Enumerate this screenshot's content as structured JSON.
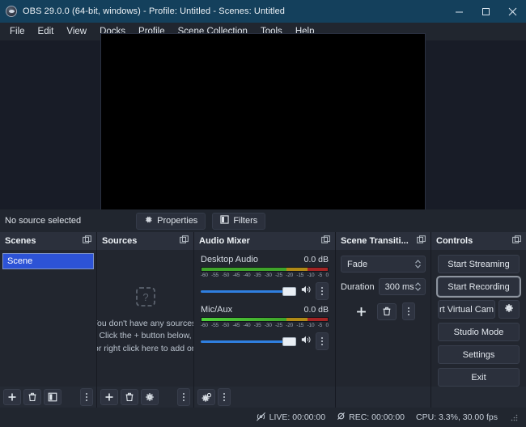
{
  "window": {
    "title": "OBS 29.0.0 (64-bit, windows) - Profile: Untitled - Scenes: Untitled",
    "app_icon": "obs-logo-icon",
    "minimize_label": "–",
    "maximize_label": "☐",
    "close_label": "✕",
    "titlebar_color": "#14405c"
  },
  "menubar": {
    "items": [
      {
        "label": "File"
      },
      {
        "label": "Edit"
      },
      {
        "label": "View"
      },
      {
        "label": "Docks"
      },
      {
        "label": "Profile"
      },
      {
        "label": "Scene Collection"
      },
      {
        "label": "Tools"
      },
      {
        "label": "Help"
      }
    ]
  },
  "preview": {
    "canvas_color": "#000000"
  },
  "source_toolbar": {
    "status_text": "No source selected",
    "properties_label": "Properties",
    "properties_icon": "gear-icon",
    "filters_label": "Filters",
    "filters_icon": "filters-icon"
  },
  "scenes": {
    "title": "Scenes",
    "float_icon": "float-dock-icon",
    "items": [
      {
        "name": "Scene",
        "selected": true
      }
    ],
    "footer": [
      {
        "icon": "plus-icon",
        "name": "add-scene-button"
      },
      {
        "icon": "trash-icon",
        "name": "remove-scene-button"
      },
      {
        "icon": "scene-filters-icon",
        "name": "scene-filters-button"
      },
      {
        "icon": "kebab-icon",
        "name": "scene-options-button"
      }
    ]
  },
  "sources": {
    "title": "Sources",
    "float_icon": "float-dock-icon",
    "placeholder_icon": "question-box-icon",
    "placeholder_lines": [
      "You don't have any sources.",
      "Click the + button below,",
      "or right click here to add one."
    ],
    "footer": [
      {
        "icon": "plus-icon",
        "name": "add-source-button"
      },
      {
        "icon": "trash-icon",
        "name": "remove-source-button"
      },
      {
        "icon": "gear-icon",
        "name": "source-properties-button"
      },
      {
        "icon": "kebab-icon",
        "name": "source-options-button"
      }
    ]
  },
  "audio_mixer": {
    "title": "Audio Mixer",
    "float_icon": "float-dock-icon",
    "tick_labels": [
      "-60",
      "-55",
      "-50",
      "-45",
      "-40",
      "-35",
      "-30",
      "-25",
      "-20",
      "-15",
      "-10",
      "-5",
      "0"
    ],
    "channels": [
      {
        "name": "Desktop Audio",
        "db": "0.0 dB",
        "active": false,
        "volume_percent": 100,
        "mute_icon": "speaker-icon",
        "menu_icon": "kebab-icon"
      },
      {
        "name": "Mic/Aux",
        "db": "0.0 dB",
        "active": true,
        "volume_percent": 100,
        "mute_icon": "speaker-icon",
        "menu_icon": "kebab-icon"
      }
    ],
    "footer": [
      {
        "icon": "advanced-audio-icon",
        "name": "advanced-audio-properties-button"
      },
      {
        "icon": "kebab-icon",
        "name": "mixer-options-button"
      }
    ]
  },
  "transitions": {
    "title": "Scene Transiti...",
    "float_icon": "float-dock-icon",
    "transition_value": "Fade",
    "duration_label": "Duration",
    "duration_value": "300 ms",
    "buttons": [
      {
        "icon": "plus-icon",
        "name": "add-transition-button"
      },
      {
        "icon": "trash-icon",
        "name": "remove-transition-button"
      },
      {
        "icon": "kebab-icon",
        "name": "transition-options-button"
      }
    ]
  },
  "controls": {
    "title": "Controls",
    "float_icon": "float-dock-icon",
    "start_streaming": "Start Streaming",
    "start_recording": "Start Recording",
    "virtual_cam": "rt Virtual Cam",
    "virtual_cam_gear_icon": "gear-icon",
    "studio_mode": "Studio Mode",
    "settings": "Settings",
    "exit": "Exit",
    "focused_button": "start_recording"
  },
  "statusbar": {
    "live_icon": "stream-off-icon",
    "live_text": "LIVE: 00:00:00",
    "rec_icon": "record-off-icon",
    "rec_text": "REC: 00:00:00",
    "cpu_text": "CPU: 3.3%, 30.00 fps",
    "grip_icon": "resize-grip-icon"
  }
}
